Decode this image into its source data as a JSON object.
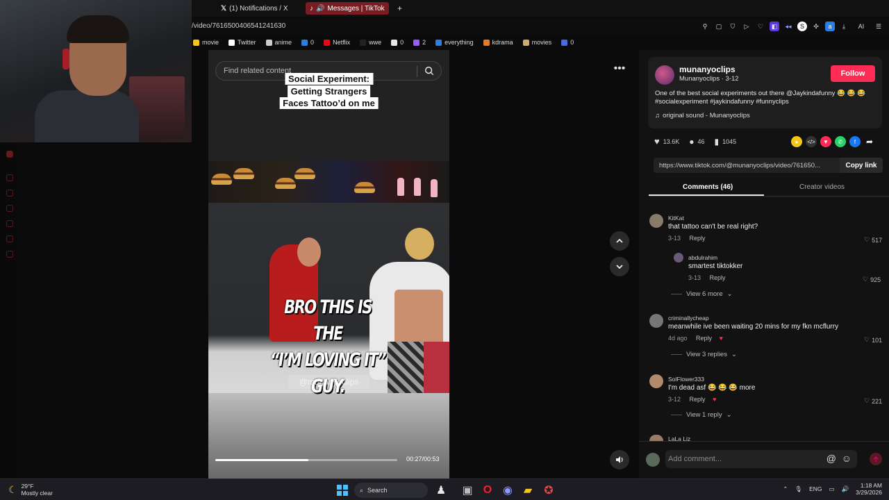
{
  "browser": {
    "tabs": [
      {
        "label": "(1) Notifications / X",
        "active": false
      },
      {
        "label": "Messages | TikTok",
        "active": true
      }
    ],
    "new_tab_label": "+",
    "url": "/video/7616500406541241630",
    "bookmarks": [
      {
        "label": "movie",
        "color": "#f5c518"
      },
      {
        "label": "Twitter",
        "color": "#ffffff"
      },
      {
        "label": "anime",
        "color": "#cccccc"
      },
      {
        "label": "0",
        "color": "#2a7fe0"
      },
      {
        "label": "Netflix",
        "color": "#e50914"
      },
      {
        "label": "wwe",
        "color": "#222222"
      },
      {
        "label": "0",
        "color": "#e8e8e8"
      },
      {
        "label": "2",
        "color": "#9b59ff"
      },
      {
        "label": "everything",
        "color": "#2a7fe0"
      },
      {
        "label": "kdrama",
        "color": "#e07b2a"
      },
      {
        "label": "movies",
        "color": "#d4a86a"
      },
      {
        "label": "0",
        "color": "#4a6ae0"
      }
    ],
    "extension_label": "AI"
  },
  "video": {
    "search_placeholder": "Find related content",
    "caption_lines": [
      "Social Experiment:",
      "Getting Strangers",
      "Faces Tattoo’d on me"
    ],
    "overlay_lines": [
      "BRO THIS IS THE",
      "“I’M LOVING IT” GUY."
    ],
    "watermark": "@munanyoclips",
    "progress_fraction": 0.51,
    "timecode": "00:27/00:53"
  },
  "author": {
    "name": "munanyoclips",
    "subtitle": "Munanyoclips · 3-12",
    "follow_label": "Follow",
    "description": "One of the best social experiments out there @Jaykindafunny 😂 😂 😂 #socialexperiment #jaykindafunny #funnyclips",
    "sound": "original sound - Munanyoclips"
  },
  "stats": {
    "likes": "13.6K",
    "comments": "46",
    "saves": "1045"
  },
  "share_link": {
    "url": "https://www.tiktok.com/@munanyoclips/video/761650...",
    "copy_label": "Copy link"
  },
  "tabs": {
    "comments": "Comments (46)",
    "creator": "Creator videos"
  },
  "comments": [
    {
      "user": "KitKat",
      "text": "that tattoo can't be real right?",
      "date": "3-13",
      "reply": "Reply",
      "likes": "517"
    },
    {
      "user": "abdulrahim",
      "text": "smartest tiktokker",
      "date": "3-13",
      "reply": "Reply",
      "likes": "925"
    },
    {
      "view_more": "View 6 more"
    },
    {
      "user": "criminallycheap",
      "text": "meanwhile ive been waiting 20 mins for my fkn mcflurry",
      "date": "4d ago",
      "reply": "Reply",
      "likes": "101"
    },
    {
      "view_more": "View 3 replies"
    },
    {
      "user": "SolFlower333",
      "text": "I'm dead asf 😂 😂 😂 more",
      "date": "3-12",
      "reply": "Reply",
      "likes": "221"
    },
    {
      "view_more": "View 1 reply"
    },
    {
      "user": "LaLa Liz"
    }
  ],
  "add_comment_placeholder": "Add comment...",
  "taskbar": {
    "temp": "29°F",
    "weather": "Mostly clear",
    "search": "Search",
    "lang": "ENG",
    "time": "1:18 AM",
    "date": "3/29/2026"
  },
  "colors": {
    "accent": "#fe2c55",
    "tab_active": "#7a1c24"
  }
}
